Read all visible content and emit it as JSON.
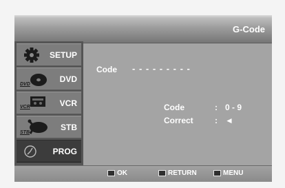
{
  "header": {
    "title": "G-Code"
  },
  "sidebar": {
    "items": [
      {
        "label": "SETUP",
        "icon": "gear-icon",
        "selected": false
      },
      {
        "label": "DVD",
        "icon": "dvd-disc-icon",
        "caption": "DVD",
        "selected": false
      },
      {
        "label": "VCR",
        "icon": "vcr-cassette-icon",
        "caption": "VCR",
        "selected": false
      },
      {
        "label": "STB",
        "icon": "stb-dish-icon",
        "caption": "STB",
        "selected": false
      },
      {
        "label": "PROG",
        "icon": "clock-icon",
        "selected": true
      }
    ]
  },
  "main": {
    "code_label": "Code",
    "code_value": "- - - - - - - - -",
    "hints": [
      {
        "key": "Code",
        "sep": ":",
        "value": "0 - 9"
      },
      {
        "key": "Correct",
        "sep": ":",
        "value": "◄"
      }
    ]
  },
  "footer": {
    "buttons": [
      {
        "label": "OK",
        "icon": "ok-key-icon"
      },
      {
        "label": "RETURN",
        "icon": "return-key-icon"
      },
      {
        "label": "MENU",
        "icon": "menu-key-icon"
      }
    ]
  },
  "colors": {
    "panel": "#a4a4a4",
    "sidebar": "#555555",
    "menu_item": "#7d7d7d",
    "menu_selected": "#3c3c3c",
    "text": "#ffffff"
  }
}
